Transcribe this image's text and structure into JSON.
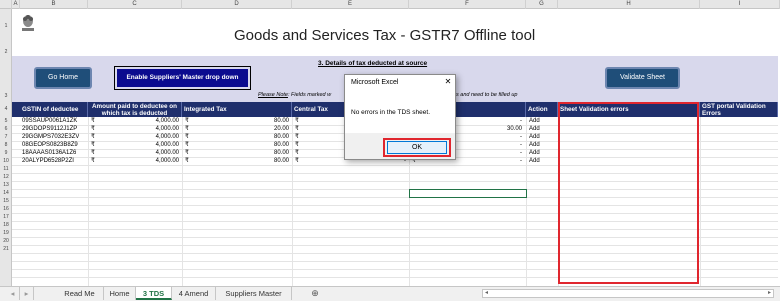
{
  "columns": [
    "A",
    "B",
    "C",
    "D",
    "E",
    "F",
    "G",
    "H",
    "I"
  ],
  "rows": [
    "1",
    "2",
    "3",
    "4",
    "5",
    "6",
    "7",
    "8",
    "9",
    "10",
    "11",
    "12",
    "13",
    "14",
    "15",
    "16",
    "17",
    "18",
    "19",
    "20",
    "21"
  ],
  "banner": {
    "title": "Goods and Services Tax - GSTR7 Offline tool"
  },
  "buttons": {
    "home": "Go Home",
    "enable": "Enable Suppliers' Master drop down",
    "validate": "Validate Sheet"
  },
  "section_title": "3. Details of tax deducted at source",
  "note_label": "Please Note",
  "note_text": ": Fields marked w",
  "note_text_right": "s and need to be filled up",
  "headers": {
    "gstin": "GSTIN of deductee",
    "amount": "Amount paid to deductee on which tax is deducted",
    "integrated": "Integrated Tax",
    "central": "Central Tax",
    "action": "Action",
    "validation": "Sheet Validation errors",
    "portal": "GST portal Validation Errors"
  },
  "currency": "₹",
  "table_rows": [
    {
      "gstin": "09SSAUP0061A1ZK",
      "amount": "4,000.00",
      "integrated": "80.00",
      "central": "",
      "state": "-",
      "action": "Add"
    },
    {
      "gstin": "29GDOPS9112J1ZP",
      "amount": "4,000.00",
      "integrated": "20.00",
      "central": "",
      "state": "30.00",
      "action": "Add"
    },
    {
      "gstin": "29GGMPS7032E3ZV",
      "amount": "4,000.00",
      "integrated": "80.00",
      "central": "",
      "state": "-",
      "action": "Add"
    },
    {
      "gstin": "08GEOPS0823B8Z9",
      "amount": "4,000.00",
      "integrated": "80.00",
      "central": "",
      "state": "-",
      "action": "Add"
    },
    {
      "gstin": "18AAAAS0136A1Z6",
      "amount": "4,000.00",
      "integrated": "80.00",
      "central": "-",
      "state": "-",
      "action": "Add"
    },
    {
      "gstin": "20ALYPD6528P2ZI",
      "amount": "4,000.00",
      "integrated": "80.00",
      "central": "-",
      "state": "-",
      "action": "Add"
    }
  ],
  "dialog": {
    "title": "Microsoft Excel",
    "message": "No errors in the TDS sheet.",
    "ok": "OK",
    "close": "✕"
  },
  "tabs": [
    "Read Me",
    "Home",
    "3 TDS",
    "4 Amend",
    "Suppliers Master"
  ],
  "active_tab": "3 TDS",
  "colors": {
    "header_bg": "#1f2f6c",
    "band_bg": "#d8d8ec",
    "highlight_red": "#e0262e",
    "active_tab": "#217346"
  }
}
